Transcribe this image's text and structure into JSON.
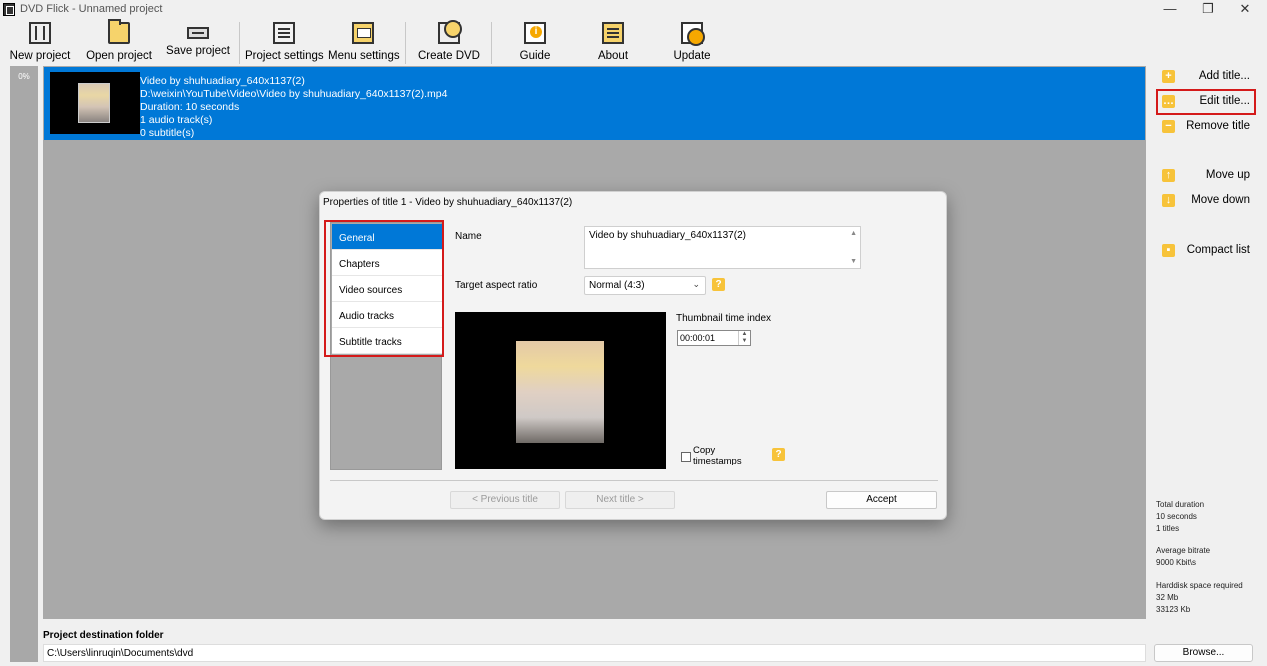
{
  "window": {
    "title": "DVD Flick - Unnamed project",
    "controls": [
      "—",
      "❐",
      "✕"
    ]
  },
  "toolbar": {
    "buttons": [
      {
        "label": "New project",
        "icon": "new-project-icon"
      },
      {
        "label": "Open project",
        "icon": "folder-icon"
      },
      {
        "label": "Save project",
        "icon": "save-icon"
      },
      {
        "label": "Project settings",
        "icon": "settings-icon"
      },
      {
        "label": "Menu settings",
        "icon": "menu-icon"
      },
      {
        "label": "Create DVD",
        "icon": "dvd-icon"
      },
      {
        "label": "Guide",
        "icon": "guide-icon"
      },
      {
        "label": "About",
        "icon": "about-icon"
      },
      {
        "label": "Update",
        "icon": "update-icon"
      }
    ]
  },
  "progress": {
    "percent_label": "0%",
    "value": 0
  },
  "title_list": {
    "items": [
      {
        "name": "Video by shuhuadiary_640x1137(2)",
        "path": "D:\\weixin\\YouTube\\Video\\Video by shuhuadiary_640x1137(2).mp4",
        "duration": "Duration: 10 seconds",
        "audio": "1 audio track(s)",
        "subtitles": "0 subtitle(s)"
      }
    ]
  },
  "side_panel": {
    "add": "Add title...",
    "edit": "Edit title...",
    "remove": "Remove title",
    "move_up": "Move up",
    "move_down": "Move down",
    "compact": "Compact list"
  },
  "stats": {
    "total_duration_label": "Total duration",
    "total_duration": "10 seconds",
    "titles": "1 titles",
    "bitrate_label": "Average bitrate",
    "bitrate": "9000 Kbit\\s",
    "hdd_label": "Harddisk space required",
    "hdd_mb": "32 Mb",
    "hdd_kb": "33123 Kb"
  },
  "destination": {
    "label": "Project destination folder",
    "value": "C:\\Users\\linruqin\\Documents\\dvd",
    "browse": "Browse..."
  },
  "dialog": {
    "title": "Properties of title 1 - Video by shuhuadiary_640x1137(2)",
    "tabs": [
      "General",
      "Chapters",
      "Video sources",
      "Audio tracks",
      "Subtitle tracks"
    ],
    "active_tab": "General",
    "name_label": "Name",
    "name_value": "Video by shuhuadiary_640x1137(2)",
    "aspect_label": "Target aspect ratio",
    "aspect_value": "Normal (4:3)",
    "thumb_label": "Thumbnail time index",
    "thumb_value": "00:00:01",
    "copy_label": "Copy timestamps",
    "prev_btn": "< Previous title",
    "next_btn": "Next title >",
    "accept_btn": "Accept"
  },
  "colors": {
    "accent": "#0078d7",
    "highlight": "#d41a1a",
    "icon_yellow": "#f7c33a"
  }
}
